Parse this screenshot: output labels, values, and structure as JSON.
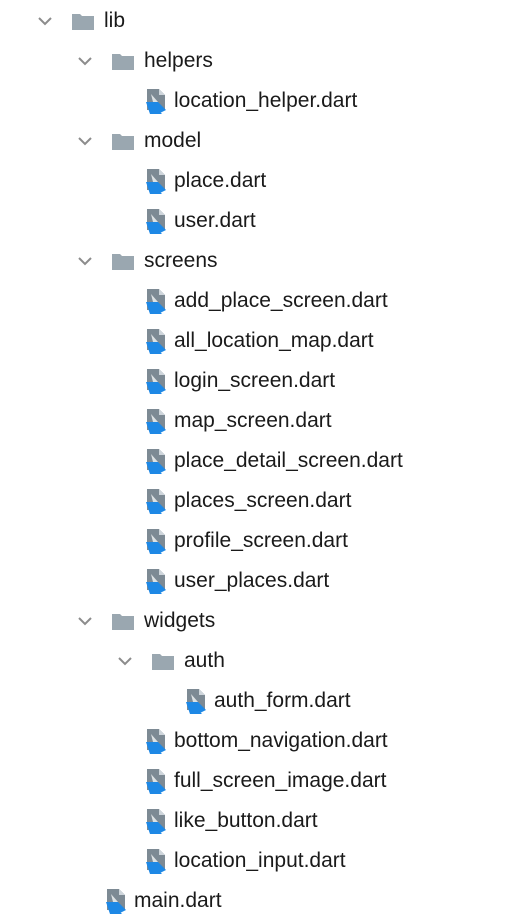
{
  "tree": [
    {
      "label": "lib",
      "type": "folder",
      "depth": 0,
      "expanded": true
    },
    {
      "label": "helpers",
      "type": "folder",
      "depth": 1,
      "expanded": true
    },
    {
      "label": "location_helper.dart",
      "type": "file",
      "depth": 2
    },
    {
      "label": "model",
      "type": "folder",
      "depth": 1,
      "expanded": true
    },
    {
      "label": "place.dart",
      "type": "file",
      "depth": 2
    },
    {
      "label": "user.dart",
      "type": "file",
      "depth": 2
    },
    {
      "label": "screens",
      "type": "folder",
      "depth": 1,
      "expanded": true
    },
    {
      "label": "add_place_screen.dart",
      "type": "file",
      "depth": 2
    },
    {
      "label": "all_location_map.dart",
      "type": "file",
      "depth": 2
    },
    {
      "label": "login_screen.dart",
      "type": "file",
      "depth": 2
    },
    {
      "label": "map_screen.dart",
      "type": "file",
      "depth": 2
    },
    {
      "label": "place_detail_screen.dart",
      "type": "file",
      "depth": 2
    },
    {
      "label": "places_screen.dart",
      "type": "file",
      "depth": 2
    },
    {
      "label": "profile_screen.dart",
      "type": "file",
      "depth": 2
    },
    {
      "label": "user_places.dart",
      "type": "file",
      "depth": 2
    },
    {
      "label": "widgets",
      "type": "folder",
      "depth": 1,
      "expanded": true
    },
    {
      "label": "auth",
      "type": "folder",
      "depth": 2,
      "expanded": true
    },
    {
      "label": "auth_form.dart",
      "type": "file",
      "depth": 3
    },
    {
      "label": "bottom_navigation.dart",
      "type": "file",
      "depth": 2
    },
    {
      "label": "full_screen_image.dart",
      "type": "file",
      "depth": 2
    },
    {
      "label": "like_button.dart",
      "type": "file",
      "depth": 2
    },
    {
      "label": "location_input.dart",
      "type": "file",
      "depth": 2
    },
    {
      "label": "main.dart",
      "type": "file",
      "depth": 1
    }
  ],
  "colors": {
    "folder": "#9aa7b0",
    "chevron": "#8c8c8c",
    "file_body": "#7d8a94",
    "file_accent": "#1e88e5",
    "text": "#1a1a1a"
  },
  "icons": {
    "folder": "folder-icon",
    "file": "dart-file-icon",
    "chevron": "chevron-down-icon"
  }
}
